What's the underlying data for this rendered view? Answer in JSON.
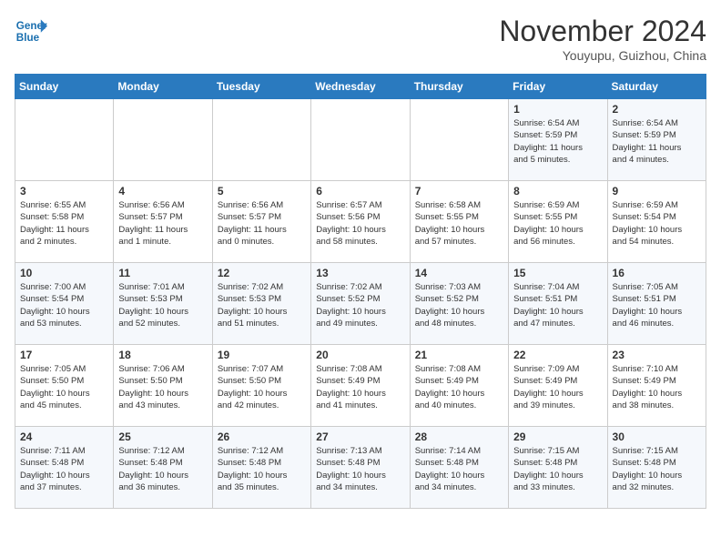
{
  "header": {
    "logo_line1": "General",
    "logo_line2": "Blue",
    "month": "November 2024",
    "location": "Youyupu, Guizhou, China"
  },
  "weekdays": [
    "Sunday",
    "Monday",
    "Tuesday",
    "Wednesday",
    "Thursday",
    "Friday",
    "Saturday"
  ],
  "weeks": [
    [
      {
        "day": "",
        "info": ""
      },
      {
        "day": "",
        "info": ""
      },
      {
        "day": "",
        "info": ""
      },
      {
        "day": "",
        "info": ""
      },
      {
        "day": "",
        "info": ""
      },
      {
        "day": "1",
        "info": "Sunrise: 6:54 AM\nSunset: 5:59 PM\nDaylight: 11 hours\nand 5 minutes."
      },
      {
        "day": "2",
        "info": "Sunrise: 6:54 AM\nSunset: 5:59 PM\nDaylight: 11 hours\nand 4 minutes."
      }
    ],
    [
      {
        "day": "3",
        "info": "Sunrise: 6:55 AM\nSunset: 5:58 PM\nDaylight: 11 hours\nand 2 minutes."
      },
      {
        "day": "4",
        "info": "Sunrise: 6:56 AM\nSunset: 5:57 PM\nDaylight: 11 hours\nand 1 minute."
      },
      {
        "day": "5",
        "info": "Sunrise: 6:56 AM\nSunset: 5:57 PM\nDaylight: 11 hours\nand 0 minutes."
      },
      {
        "day": "6",
        "info": "Sunrise: 6:57 AM\nSunset: 5:56 PM\nDaylight: 10 hours\nand 58 minutes."
      },
      {
        "day": "7",
        "info": "Sunrise: 6:58 AM\nSunset: 5:55 PM\nDaylight: 10 hours\nand 57 minutes."
      },
      {
        "day": "8",
        "info": "Sunrise: 6:59 AM\nSunset: 5:55 PM\nDaylight: 10 hours\nand 56 minutes."
      },
      {
        "day": "9",
        "info": "Sunrise: 6:59 AM\nSunset: 5:54 PM\nDaylight: 10 hours\nand 54 minutes."
      }
    ],
    [
      {
        "day": "10",
        "info": "Sunrise: 7:00 AM\nSunset: 5:54 PM\nDaylight: 10 hours\nand 53 minutes."
      },
      {
        "day": "11",
        "info": "Sunrise: 7:01 AM\nSunset: 5:53 PM\nDaylight: 10 hours\nand 52 minutes."
      },
      {
        "day": "12",
        "info": "Sunrise: 7:02 AM\nSunset: 5:53 PM\nDaylight: 10 hours\nand 51 minutes."
      },
      {
        "day": "13",
        "info": "Sunrise: 7:02 AM\nSunset: 5:52 PM\nDaylight: 10 hours\nand 49 minutes."
      },
      {
        "day": "14",
        "info": "Sunrise: 7:03 AM\nSunset: 5:52 PM\nDaylight: 10 hours\nand 48 minutes."
      },
      {
        "day": "15",
        "info": "Sunrise: 7:04 AM\nSunset: 5:51 PM\nDaylight: 10 hours\nand 47 minutes."
      },
      {
        "day": "16",
        "info": "Sunrise: 7:05 AM\nSunset: 5:51 PM\nDaylight: 10 hours\nand 46 minutes."
      }
    ],
    [
      {
        "day": "17",
        "info": "Sunrise: 7:05 AM\nSunset: 5:50 PM\nDaylight: 10 hours\nand 45 minutes."
      },
      {
        "day": "18",
        "info": "Sunrise: 7:06 AM\nSunset: 5:50 PM\nDaylight: 10 hours\nand 43 minutes."
      },
      {
        "day": "19",
        "info": "Sunrise: 7:07 AM\nSunset: 5:50 PM\nDaylight: 10 hours\nand 42 minutes."
      },
      {
        "day": "20",
        "info": "Sunrise: 7:08 AM\nSunset: 5:49 PM\nDaylight: 10 hours\nand 41 minutes."
      },
      {
        "day": "21",
        "info": "Sunrise: 7:08 AM\nSunset: 5:49 PM\nDaylight: 10 hours\nand 40 minutes."
      },
      {
        "day": "22",
        "info": "Sunrise: 7:09 AM\nSunset: 5:49 PM\nDaylight: 10 hours\nand 39 minutes."
      },
      {
        "day": "23",
        "info": "Sunrise: 7:10 AM\nSunset: 5:49 PM\nDaylight: 10 hours\nand 38 minutes."
      }
    ],
    [
      {
        "day": "24",
        "info": "Sunrise: 7:11 AM\nSunset: 5:48 PM\nDaylight: 10 hours\nand 37 minutes."
      },
      {
        "day": "25",
        "info": "Sunrise: 7:12 AM\nSunset: 5:48 PM\nDaylight: 10 hours\nand 36 minutes."
      },
      {
        "day": "26",
        "info": "Sunrise: 7:12 AM\nSunset: 5:48 PM\nDaylight: 10 hours\nand 35 minutes."
      },
      {
        "day": "27",
        "info": "Sunrise: 7:13 AM\nSunset: 5:48 PM\nDaylight: 10 hours\nand 34 minutes."
      },
      {
        "day": "28",
        "info": "Sunrise: 7:14 AM\nSunset: 5:48 PM\nDaylight: 10 hours\nand 34 minutes."
      },
      {
        "day": "29",
        "info": "Sunrise: 7:15 AM\nSunset: 5:48 PM\nDaylight: 10 hours\nand 33 minutes."
      },
      {
        "day": "30",
        "info": "Sunrise: 7:15 AM\nSunset: 5:48 PM\nDaylight: 10 hours\nand 32 minutes."
      }
    ]
  ]
}
